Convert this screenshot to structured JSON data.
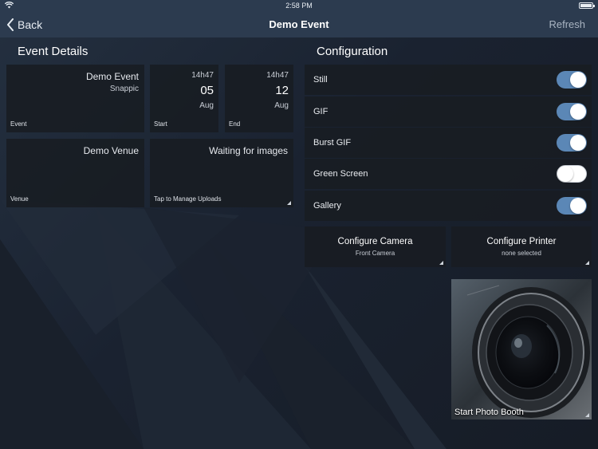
{
  "status_bar": {
    "time": "2:58 PM"
  },
  "nav": {
    "back_label": "Back",
    "title": "Demo Event",
    "refresh_label": "Refresh"
  },
  "event_details": {
    "title": "Event Details",
    "event": {
      "name": "Demo Event",
      "sub": "Snappic",
      "caption": "Event"
    },
    "start": {
      "time": "14h47",
      "day": "05",
      "month": "Aug",
      "caption": "Start"
    },
    "end": {
      "time": "14h47",
      "day": "12",
      "month": "Aug",
      "caption": "End"
    },
    "venue": {
      "name": "Demo Venue",
      "caption": "Venue"
    },
    "uploads": {
      "status": "Waiting for images",
      "caption": "Tap to Manage Uploads"
    }
  },
  "configuration": {
    "title": "Configuration",
    "options": [
      {
        "label": "Still",
        "on": true
      },
      {
        "label": "GIF",
        "on": true
      },
      {
        "label": "Burst GIF",
        "on": true
      },
      {
        "label": "Green Screen",
        "on": false
      },
      {
        "label": "Gallery",
        "on": true
      }
    ],
    "camera": {
      "label": "Configure Camera",
      "sub": "Front Camera"
    },
    "printer": {
      "label": "Configure Printer",
      "sub": "none selected"
    },
    "start_booth": {
      "label": "Start Photo Booth"
    }
  },
  "colors": {
    "nav_bg": "#2c3b4f",
    "toggle_on": "#5b87b6",
    "tile_bg": "#181c22"
  }
}
